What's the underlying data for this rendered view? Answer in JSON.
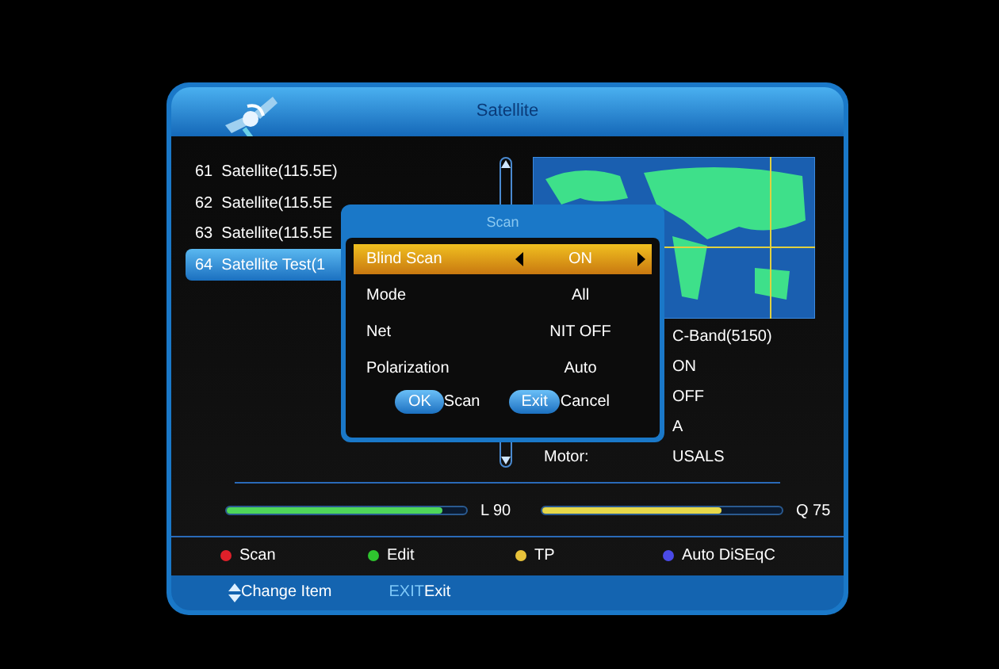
{
  "window": {
    "title": "Satellite"
  },
  "satellites": [
    {
      "label": "61  Satellite(115.5E)",
      "selected": false
    },
    {
      "label": "62  Satellite(115.5E",
      "selected": false
    },
    {
      "label": "63  Satellite(115.5E",
      "selected": false
    },
    {
      "label": "64  Satellite Test(1",
      "selected": true
    }
  ],
  "info": [
    {
      "value": "C-Band(5150)"
    },
    {
      "value": "ON"
    },
    {
      "value": "OFF"
    },
    {
      "value": "A"
    },
    {
      "label": "Motor:",
      "value": "USALS"
    }
  ],
  "signal": [
    {
      "reading": "L 90",
      "level": 0.9,
      "color": "#4fd65a"
    },
    {
      "reading": "Q 75",
      "level": 0.75,
      "color": "#e6d84a"
    }
  ],
  "color_keys": [
    {
      "color": "#e0202a",
      "label": "Scan"
    },
    {
      "color": "#2fc42f",
      "label": "Edit"
    },
    {
      "color": "#e8c23a",
      "label": "TP"
    },
    {
      "color": "#4a4ae8",
      "label": "Auto DiSEqC"
    }
  ],
  "hints": [
    {
      "kind": "arrows",
      "label": "Change Item"
    },
    {
      "kind": "key",
      "key": "EXIT",
      "label": "Exit"
    }
  ],
  "dialog": {
    "title": "Scan",
    "rows": [
      {
        "label": "Blind Scan",
        "value": "ON",
        "selected": true
      },
      {
        "label": "Mode",
        "value": "All",
        "selected": false
      },
      {
        "label": "Net",
        "value": "NIT OFF",
        "selected": false
      },
      {
        "label": "Polarization",
        "value": "Auto",
        "selected": false
      }
    ],
    "buttons": [
      {
        "key": "OK",
        "label": "Scan"
      },
      {
        "key": "Exit",
        "label": "Cancel"
      }
    ]
  }
}
